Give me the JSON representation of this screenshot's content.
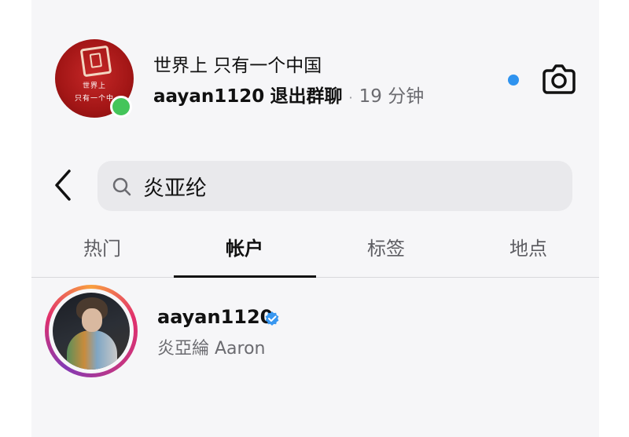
{
  "chat": {
    "title": "世界上 只有一个中国",
    "last_message_sender": "aayan1120",
    "last_message_action": "退出群聊",
    "separator": "·",
    "time": "19 分钟",
    "avatar_text_line1": "世界上",
    "avatar_text_line2": "只有一个中"
  },
  "search": {
    "query": "炎亚纶",
    "icon": "search-icon"
  },
  "tabs": [
    {
      "label": "热门",
      "active": false
    },
    {
      "label": "帐户",
      "active": true
    },
    {
      "label": "标签",
      "active": false
    },
    {
      "label": "地点",
      "active": false
    }
  ],
  "results": [
    {
      "username": "aayan1120",
      "full_name": "炎亞綸 Aaron",
      "verified": true,
      "has_story": true
    }
  ],
  "colors": {
    "unread_dot": "#2f93ef",
    "online_dot": "#44c55a",
    "verified_badge": "#3897f0"
  }
}
